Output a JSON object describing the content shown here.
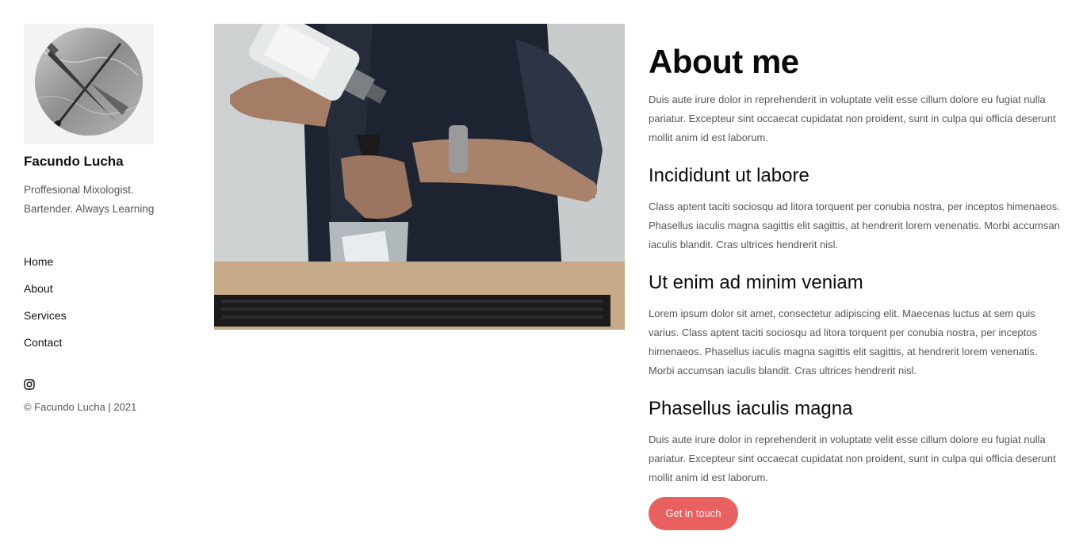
{
  "profile": {
    "name": "Facundo Lucha",
    "tagline": "Proffesional Mixologist. Bartender. Always Learning"
  },
  "nav": {
    "items": [
      {
        "label": "Home"
      },
      {
        "label": "About"
      },
      {
        "label": "Services"
      },
      {
        "label": "Contact"
      }
    ]
  },
  "social": {
    "icon": "instagram-icon"
  },
  "footer": {
    "copyright": "© Facundo Lucha | 2021"
  },
  "main": {
    "title": "About me",
    "intro": "Duis aute irure dolor in reprehenderit in voluptate velit esse cillum dolore eu fugiat nulla pariatur. Excepteur sint occaecat cupidatat non proident, sunt in culpa qui officia deserunt mollit anim id est laborum.",
    "sections": [
      {
        "heading": "Incididunt ut labore",
        "text": "Class aptent taciti sociosqu ad litora torquent per conubia nostra, per inceptos himenaeos. Phasellus iaculis magna sagittis elit sagittis, at hendrerit lorem venenatis. Morbi accumsan iaculis blandit. Cras ultrices hendrerit nisl."
      },
      {
        "heading": "Ut enim ad minim veniam",
        "text": "Lorem ipsum dolor sit amet, consectetur adipiscing elit. Maecenas luctus at sem quis varius. Class aptent taciti sociosqu ad litora torquent per conubia nostra, per inceptos himenaeos. Phasellus iaculis magna sagittis elit sagittis, at hendrerit lorem venenatis. Morbi accumsan iaculis blandit. Cras ultrices hendrerit nisl."
      },
      {
        "heading": "Phasellus iaculis magna",
        "text": "Duis aute irure dolor in reprehenderit in voluptate velit esse cillum dolore eu fugiat nulla pariatur. Excepteur sint occaecat cupidatat non proident, sunt in culpa qui officia deserunt mollit anim id est laborum."
      }
    ],
    "cta_label": "Get in touch"
  },
  "colors": {
    "accent": "#e96060",
    "text_muted": "#555555",
    "heading": "#0a0a0a"
  }
}
